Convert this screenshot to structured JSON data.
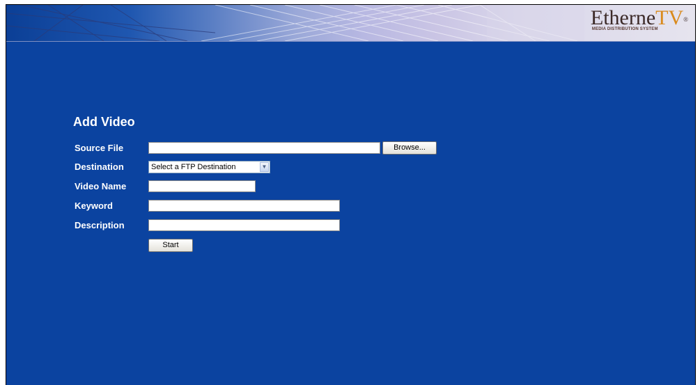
{
  "brand": {
    "logo_text": "EtherneTV",
    "logo_subtitle": "MEDIA DISTRIBUTION SYSTEM"
  },
  "form": {
    "title": "Add Video",
    "source_file": {
      "label": "Source File",
      "value": "",
      "browse_label": "Browse..."
    },
    "destination": {
      "label": "Destination",
      "selected": "Select a FTP Destination"
    },
    "video_name": {
      "label": "Video Name",
      "value": ""
    },
    "keyword": {
      "label": "Keyword",
      "value": ""
    },
    "description": {
      "label": "Description",
      "value": ""
    },
    "start_label": "Start"
  },
  "colors": {
    "background": "#0b43a0",
    "logo_accent": "#d98a1c"
  }
}
